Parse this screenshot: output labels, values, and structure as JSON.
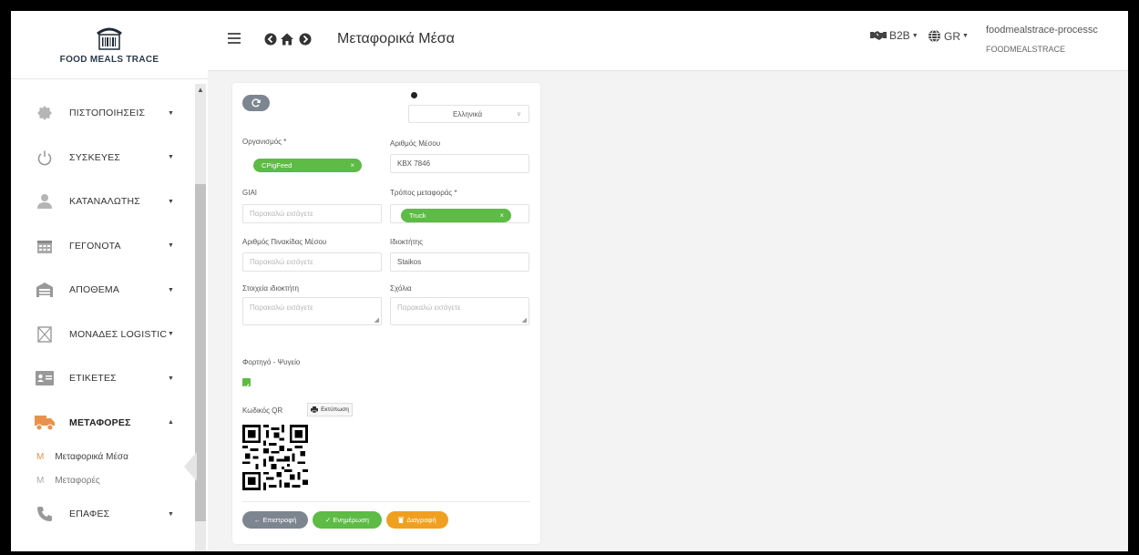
{
  "brand": {
    "name": "FOOD MEALS TRACE"
  },
  "sidebar": {
    "items": [
      {
        "label": "ΠΙΣΤΟΠΟΙΗΣΕΙΣ",
        "icon": "badge-icon"
      },
      {
        "label": "ΣΥΣΚΕΥΕΣ",
        "icon": "power-icon"
      },
      {
        "label": "ΚΑΤΑΝΑΛΩΤΗΣ",
        "icon": "user-icon"
      },
      {
        "label": "ΓΕΓΟΝΟΤΑ",
        "icon": "calendar-icon"
      },
      {
        "label": "ΑΠΟΘΕΜΑ",
        "icon": "warehouse-icon"
      },
      {
        "label": "ΜΟΝΑΔΕΣ LOGISTIC",
        "icon": "box-icon"
      },
      {
        "label": "ΕΤΙΚΕΤΕΣ",
        "icon": "id-card-icon"
      },
      {
        "label": "ΜΕΤΑΦΟΡΕΣ",
        "icon": "truck-icon"
      },
      {
        "label": "ΕΠΑΦΕΣ",
        "icon": "phone-icon"
      }
    ],
    "subitems": [
      {
        "marker": "M",
        "label": "Μεταφορικά Μέσα"
      },
      {
        "marker": "M",
        "label": "Μεταφορές"
      }
    ]
  },
  "topbar": {
    "title": "Μεταφορικά Μέσα",
    "b2b": "B2B",
    "lang": "GR",
    "user_name": "foodmealstrace-processc",
    "user_org": "FOODMEALSTRACE"
  },
  "form": {
    "language_select": "Ελληνικά",
    "org_label": "Οργανισμός *",
    "org_tag": "CPigFeed",
    "vehicle_no_label": "Αριθμός Μέσου",
    "vehicle_no_value": "KBX 7846",
    "giai_label": "GIAI",
    "giai_placeholder": "Παρακαλώ εισάγετε",
    "mode_label": "Τρόπος μεταφοράς *",
    "mode_tag": "Truck",
    "plate_label": "Αριθμός Πινακίδας Μέσου",
    "plate_placeholder": "Παρακαλώ εισάγετε",
    "owner_label": "Ιδιοκτήτης",
    "owner_value": "Staikos",
    "owner_info_label": "Στοιχεία ιδιοκτήτη",
    "owner_info_placeholder": "Παρακαλώ εισάγετε",
    "comments_label": "Σχόλια",
    "comments_placeholder": "Παρακαλώ εισάγετε",
    "fridge_label": "Φορτηγό - Ψυγείο",
    "fridge_checked": true,
    "qr_label": "Κωδικός QR",
    "print_label": "Εκτύπωση",
    "back_label": "← Επιστροφή",
    "update_label": "✓ Ενημέρωση",
    "delete_label": "Διαγραφή"
  },
  "colors": {
    "green": "#5dbb46",
    "orange": "#f0a020",
    "gray_button": "#7d8590",
    "accent": "#e8934d"
  }
}
